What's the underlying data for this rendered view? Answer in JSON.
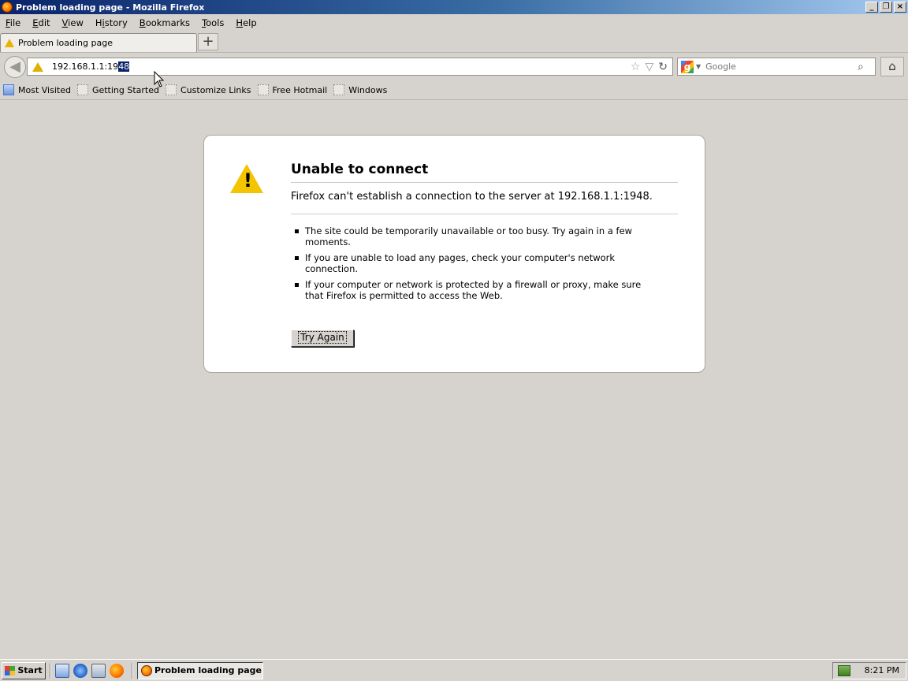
{
  "window": {
    "title": "Problem loading page - Mozilla Firefox",
    "controls": [
      "_",
      "❐",
      "×"
    ]
  },
  "menubar": {
    "items": [
      {
        "key": "F",
        "rest": "ile"
      },
      {
        "key": "E",
        "rest": "dit"
      },
      {
        "key": "V",
        "rest": "iew"
      },
      {
        "key": "H",
        "rest": "istory",
        "pre": ""
      },
      {
        "key": "B",
        "rest": "ookmarks"
      },
      {
        "key": "T",
        "rest": "ools"
      },
      {
        "key": "H",
        "rest": "elp"
      }
    ]
  },
  "tab": {
    "label": "Problem loading page",
    "new_tab": "+"
  },
  "nav": {
    "back": "◀",
    "url_plain": "192.168.1.1:19",
    "url_selected": "48",
    "star": "☆",
    "dropdown": "▽",
    "reload": "↻",
    "search_engine_logo": "g",
    "search_placeholder": "Google",
    "search_go": "⌕",
    "home": "⌂"
  },
  "bookmarks": {
    "items": [
      "Most Visited",
      "Getting Started",
      "Customize Links",
      "Free Hotmail",
      "Windows"
    ]
  },
  "error": {
    "title": "Unable to connect",
    "description": "Firefox can't establish a connection to the server at 192.168.1.1:1948.",
    "bullets": [
      "The site could be temporarily unavailable or too busy. Try again in a few moments.",
      "If you are unable to load any pages, check your computer's network connection.",
      "If your computer or network is protected by a firewall or proxy, make sure that Firefox is permitted to access the Web."
    ],
    "button": "Try Again"
  },
  "taskbar": {
    "start": "Start",
    "task_label": "Problem loading page ...",
    "clock": "8:21 PM"
  }
}
